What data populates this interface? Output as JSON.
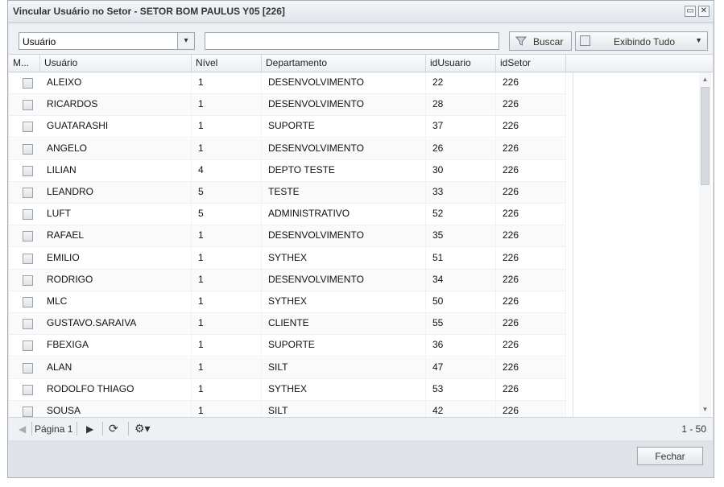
{
  "window": {
    "title": "Vincular Usuário no Setor - SETOR BOM PAULUS Y05 [226]"
  },
  "toolbar": {
    "field_select": "Usuário",
    "search_value": "",
    "search_label": "Buscar",
    "filter_label": "Exibindo Tudo"
  },
  "columns": [
    "M...",
    "Usuário",
    "Nível",
    "Departamento",
    "idUsuario",
    "idSetor"
  ],
  "rows": [
    {
      "usuario": "ALEIXO",
      "nivel": "1",
      "departamento": "DESENVOLVIMENTO",
      "idUsuario": "22",
      "idSetor": "226"
    },
    {
      "usuario": "RICARDOS",
      "nivel": "1",
      "departamento": "DESENVOLVIMENTO",
      "idUsuario": "28",
      "idSetor": "226"
    },
    {
      "usuario": "GUATARASHI",
      "nivel": "1",
      "departamento": "SUPORTE",
      "idUsuario": "37",
      "idSetor": "226"
    },
    {
      "usuario": "ANGELO",
      "nivel": "1",
      "departamento": "DESENVOLVIMENTO",
      "idUsuario": "26",
      "idSetor": "226"
    },
    {
      "usuario": "LILIAN",
      "nivel": "4",
      "departamento": "DEPTO TESTE",
      "idUsuario": "30",
      "idSetor": "226"
    },
    {
      "usuario": "LEANDRO",
      "nivel": "5",
      "departamento": "TESTE",
      "idUsuario": "33",
      "idSetor": "226"
    },
    {
      "usuario": "LUFT",
      "nivel": "5",
      "departamento": "ADMINISTRATIVO",
      "idUsuario": "52",
      "idSetor": "226"
    },
    {
      "usuario": "RAFAEL",
      "nivel": "1",
      "departamento": "DESENVOLVIMENTO",
      "idUsuario": "35",
      "idSetor": "226"
    },
    {
      "usuario": "EMILIO",
      "nivel": "1",
      "departamento": "SYTHEX",
      "idUsuario": "51",
      "idSetor": "226"
    },
    {
      "usuario": "RODRIGO",
      "nivel": "1",
      "departamento": "DESENVOLVIMENTO",
      "idUsuario": "34",
      "idSetor": "226"
    },
    {
      "usuario": "MLC",
      "nivel": "1",
      "departamento": "SYTHEX",
      "idUsuario": "50",
      "idSetor": "226"
    },
    {
      "usuario": "GUSTAVO.SARAIVA",
      "nivel": "1",
      "departamento": "CLIENTE",
      "idUsuario": "55",
      "idSetor": "226"
    },
    {
      "usuario": "FBEXIGA",
      "nivel": "1",
      "departamento": "SUPORTE",
      "idUsuario": "36",
      "idSetor": "226"
    },
    {
      "usuario": "ALAN",
      "nivel": "1",
      "departamento": "SILT",
      "idUsuario": "47",
      "idSetor": "226"
    },
    {
      "usuario": "RODOLFO THIAGO",
      "nivel": "1",
      "departamento": "SYTHEX",
      "idUsuario": "53",
      "idSetor": "226"
    },
    {
      "usuario": "SOUSA",
      "nivel": "1",
      "departamento": "SILT",
      "idUsuario": "42",
      "idSetor": "226"
    }
  ],
  "pager": {
    "page_label": "Página 1",
    "range": "1 - 50"
  },
  "footer": {
    "close_label": "Fechar"
  },
  "icons": [
    "maximize-icon",
    "close-icon",
    "chevron-down-icon",
    "funnel-icon",
    "filter-icon",
    "first-page-icon",
    "next-page-icon",
    "refresh-icon",
    "gear-icon"
  ]
}
